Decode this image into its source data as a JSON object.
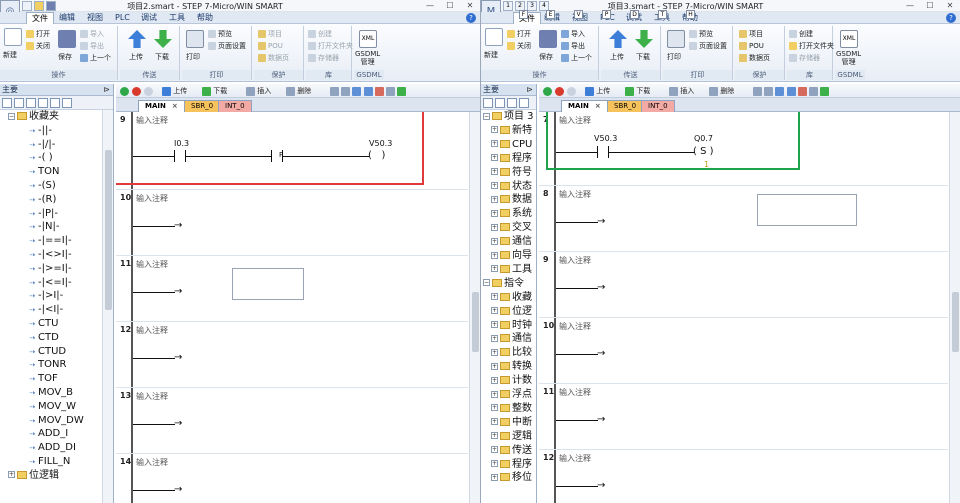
{
  "colors": {
    "red_frame": "#e03a3a",
    "green_frame": "#1ea34a",
    "sbr_tab": "#f6c25c",
    "int_tab": "#f4aaa4",
    "ribbon_accent": "#2f6ed0"
  },
  "left": {
    "title": "项目2.smart - STEP 7-Micro/WIN SMART",
    "menu": [
      "文件",
      "编辑",
      "视图",
      "PLC",
      "调试",
      "工具",
      "帮助"
    ],
    "ribbon": {
      "op_group": {
        "label": "操作",
        "new": "新建",
        "open": "打开",
        "close": "关闭",
        "save": "保存",
        "import": "导入",
        "export": "导出",
        "prev": "上一个"
      },
      "transfer_group": {
        "label": "传送",
        "upload": "上传",
        "download": "下载"
      },
      "print_group": {
        "label": "打印",
        "print": "打印",
        "preview": "预览",
        "page_setup": "页面设置"
      },
      "protect_group": {
        "label": "保护",
        "project": "项目",
        "pou": "POU",
        "data_page": "数据页"
      },
      "lib_group": {
        "label": "库",
        "create": "创建",
        "open_lib": "打开文件夹",
        "memory": "存储器"
      },
      "gsdml_group": {
        "label": "GSDML",
        "manage": "GSDML\n管理",
        "xml": "XML"
      }
    },
    "panel": {
      "title": "主要",
      "pin": "⊳"
    },
    "tree": [
      "收藏夹",
      "-||-",
      "-|/|-",
      "-( )",
      "TON",
      "-(S)",
      "-(R)",
      "-|P|-",
      "-|N|-",
      "-|==I|-",
      "-|<>I|-",
      "-|>=I|-",
      "-|<=I|-",
      "-|>I|-",
      "-|<I|-",
      "CTU",
      "CTD",
      "CTUD",
      "TONR",
      "TOF",
      "MOV_B",
      "MOV_W",
      "MOV_DW",
      "ADD_I",
      "ADD_DI",
      "FILL_N",
      "位逻辑"
    ],
    "tabs": {
      "main": "MAIN",
      "sbr": "SBR_0",
      "int": "INT_0"
    },
    "toolbar": [
      "上传",
      "下载",
      "插入",
      "删除"
    ],
    "rungs": [
      {
        "num": "9",
        "comment": "输入注释",
        "contact": "I0.3",
        "p": "P",
        "coil": "V50.3"
      },
      {
        "num": "10",
        "comment": "输入注释"
      },
      {
        "num": "11",
        "comment": "输入注释"
      },
      {
        "num": "12",
        "comment": "输入注释"
      },
      {
        "num": "13",
        "comment": "输入注释"
      },
      {
        "num": "14",
        "comment": "输入注释"
      }
    ]
  },
  "right": {
    "title": "项目3.smart - STEP 7-Micro/WIN SMART",
    "menu": [
      "文件",
      "编辑",
      "视图",
      "PLC",
      "调试",
      "工具",
      "帮助"
    ],
    "qat_keys": [
      "1",
      "2",
      "3",
      "4"
    ],
    "key_hints": [
      "F",
      "E",
      "V",
      "P",
      "D",
      "T",
      "H"
    ],
    "ribbon": {
      "op_group": {
        "label": "操作",
        "new": "新建",
        "open": "打开",
        "close": "关闭",
        "save": "保存",
        "import": "导入",
        "export": "导出",
        "prev": "上一个"
      },
      "transfer_group": {
        "label": "传送",
        "upload": "上传",
        "download": "下载"
      },
      "print_group": {
        "label": "打印",
        "print": "打印",
        "preview": "预览",
        "page_setup": "页面设置"
      },
      "protect_group": {
        "label": "保护",
        "project": "项目",
        "pou": "POU",
        "data_page": "数据页"
      },
      "lib_group": {
        "label": "库",
        "create": "创建",
        "open_lib": "打开文件夹",
        "memory": "存储器"
      },
      "gsdml_group": {
        "label": "GSDML",
        "manage": "GSDML\n管理",
        "xml": "XML"
      }
    },
    "panel": {
      "title": "主要",
      "pin": "⊳"
    },
    "tree": [
      "项目 3",
      "新特",
      "CPU",
      "程序",
      "符号",
      "状态",
      "数据",
      "系统",
      "交叉",
      "通信",
      "向导",
      "工具",
      "指令",
      "收藏",
      "位逻",
      "时钟",
      "通信",
      "比较",
      "转换",
      "计数",
      "浮点",
      "整数",
      "中断",
      "逻辑",
      "传送",
      "程序",
      "移位"
    ],
    "tabs": {
      "main": "MAIN",
      "sbr": "SBR_0",
      "int": "INT_0"
    },
    "toolbar": [
      "上传",
      "下载",
      "插入",
      "删除"
    ],
    "rungs": [
      {
        "num": "7",
        "comment": "输入注释",
        "contact": "V50.3",
        "coil": "Q0.7",
        "coil_type": "S",
        "coil_n": "1"
      },
      {
        "num": "8",
        "comment": "输入注释"
      },
      {
        "num": "9",
        "comment": "输入注释"
      },
      {
        "num": "10",
        "comment": "输入注释"
      },
      {
        "num": "11",
        "comment": "输入注释"
      },
      {
        "num": "12",
        "comment": "输入注释"
      }
    ]
  }
}
